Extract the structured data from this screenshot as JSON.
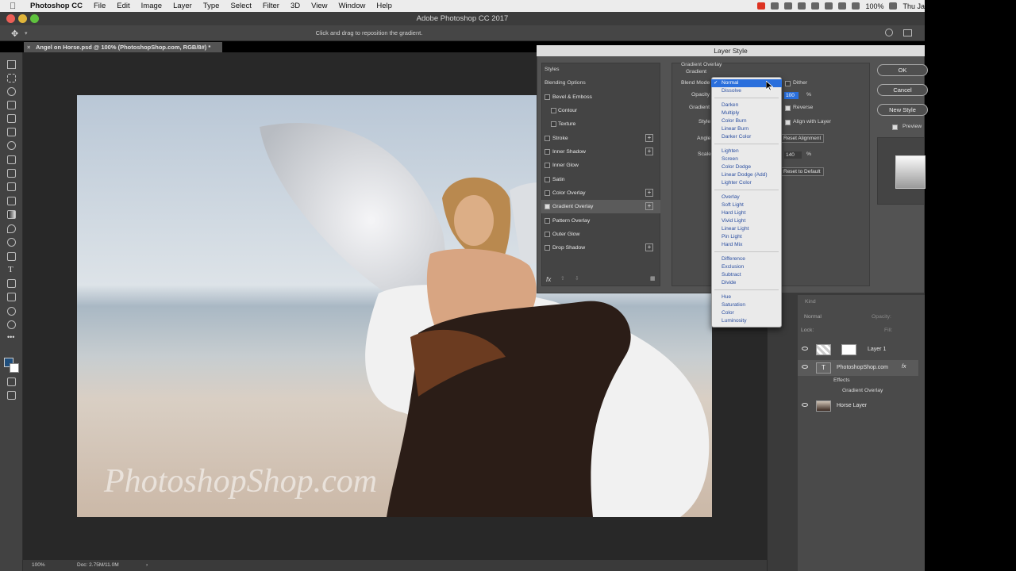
{
  "menubar": {
    "app_name": "Photoshop CC",
    "items": [
      "File",
      "Edit",
      "Image",
      "Layer",
      "Type",
      "Select",
      "Filter",
      "3D",
      "View",
      "Window",
      "Help"
    ],
    "battery": "100%",
    "clock": "Thu Ja"
  },
  "window": {
    "title": "Adobe Photoshop CC 2017"
  },
  "options_bar": {
    "hint": "Click and drag to reposition the gradient."
  },
  "document": {
    "tab_title": "Angel on Horse.psd @ 100% (PhotoshopShop.com, RGB/8#) *",
    "watermark": "PhotoshopShop.com"
  },
  "status": {
    "zoom": "100%",
    "doc_size": "Doc: 2.75M/11.0M"
  },
  "layer_style": {
    "title": "Layer Style",
    "styles_header": "Styles",
    "blending_options": "Blending Options",
    "items": [
      {
        "label": "Bevel & Emboss",
        "checked": false,
        "plus": false,
        "indent": false
      },
      {
        "label": "Contour",
        "checked": false,
        "plus": false,
        "indent": true
      },
      {
        "label": "Texture",
        "checked": false,
        "plus": false,
        "indent": true
      },
      {
        "label": "Stroke",
        "checked": false,
        "plus": true,
        "indent": false
      },
      {
        "label": "Inner Shadow",
        "checked": false,
        "plus": true,
        "indent": false
      },
      {
        "label": "Inner Glow",
        "checked": false,
        "plus": false,
        "indent": false
      },
      {
        "label": "Satin",
        "checked": false,
        "plus": false,
        "indent": false
      },
      {
        "label": "Color Overlay",
        "checked": false,
        "plus": true,
        "indent": false
      },
      {
        "label": "Gradient Overlay",
        "checked": true,
        "plus": true,
        "indent": false,
        "selected": true
      },
      {
        "label": "Pattern Overlay",
        "checked": false,
        "plus": false,
        "indent": false
      },
      {
        "label": "Outer Glow",
        "checked": false,
        "plus": false,
        "indent": false
      },
      {
        "label": "Drop Shadow",
        "checked": false,
        "plus": true,
        "indent": false
      }
    ],
    "fx_label": "fx",
    "section_title": "Gradient Overlay",
    "section_sub": "Gradient",
    "blend_mode_label": "Blend Mode",
    "opacity_label": "Opacity",
    "gradient_label": "Gradient",
    "style_label": "Style",
    "angle_label": "Angle",
    "scale_label": "Scale",
    "opacity_value": "100",
    "scale_value": "140",
    "percent": "%",
    "dither": "Dither",
    "reverse": "Reverse",
    "align_with_layer": "Align with Layer",
    "reset_alignment": "Reset Alignment",
    "reset_to_default": "Reset to Default",
    "ok": "OK",
    "cancel": "Cancel",
    "new_style": "New Style",
    "preview": "Preview"
  },
  "blend_modes": [
    [
      "Normal",
      "Dissolve"
    ],
    [
      "Darken",
      "Multiply",
      "Color Burn",
      "Linear Burn",
      "Darker Color"
    ],
    [
      "Lighten",
      "Screen",
      "Color Dodge",
      "Linear Dodge (Add)",
      "Lighter Color"
    ],
    [
      "Overlay",
      "Soft Light",
      "Hard Light",
      "Vivid Light",
      "Linear Light",
      "Pin Light",
      "Hard Mix"
    ],
    [
      "Difference",
      "Exclusion",
      "Subtract",
      "Divide"
    ],
    [
      "Hue",
      "Saturation",
      "Color",
      "Luminosity"
    ]
  ],
  "selected_blend_mode": "Normal",
  "layers_panel": {
    "kind": "Kind",
    "mode": "Normal",
    "opacity_label": "Opacity:",
    "lock_label": "Lock:",
    "fill_label": "Fill:",
    "layers": [
      {
        "name": "Layer 1"
      },
      {
        "name": "PhotoshopShop.com"
      },
      {
        "name": "Effects"
      },
      {
        "name": "Gradient Overlay"
      },
      {
        "name": "Horse Layer"
      }
    ]
  },
  "colors": {
    "accent": "#2a6fdc",
    "panel": "#535353",
    "dark": "#282828"
  }
}
